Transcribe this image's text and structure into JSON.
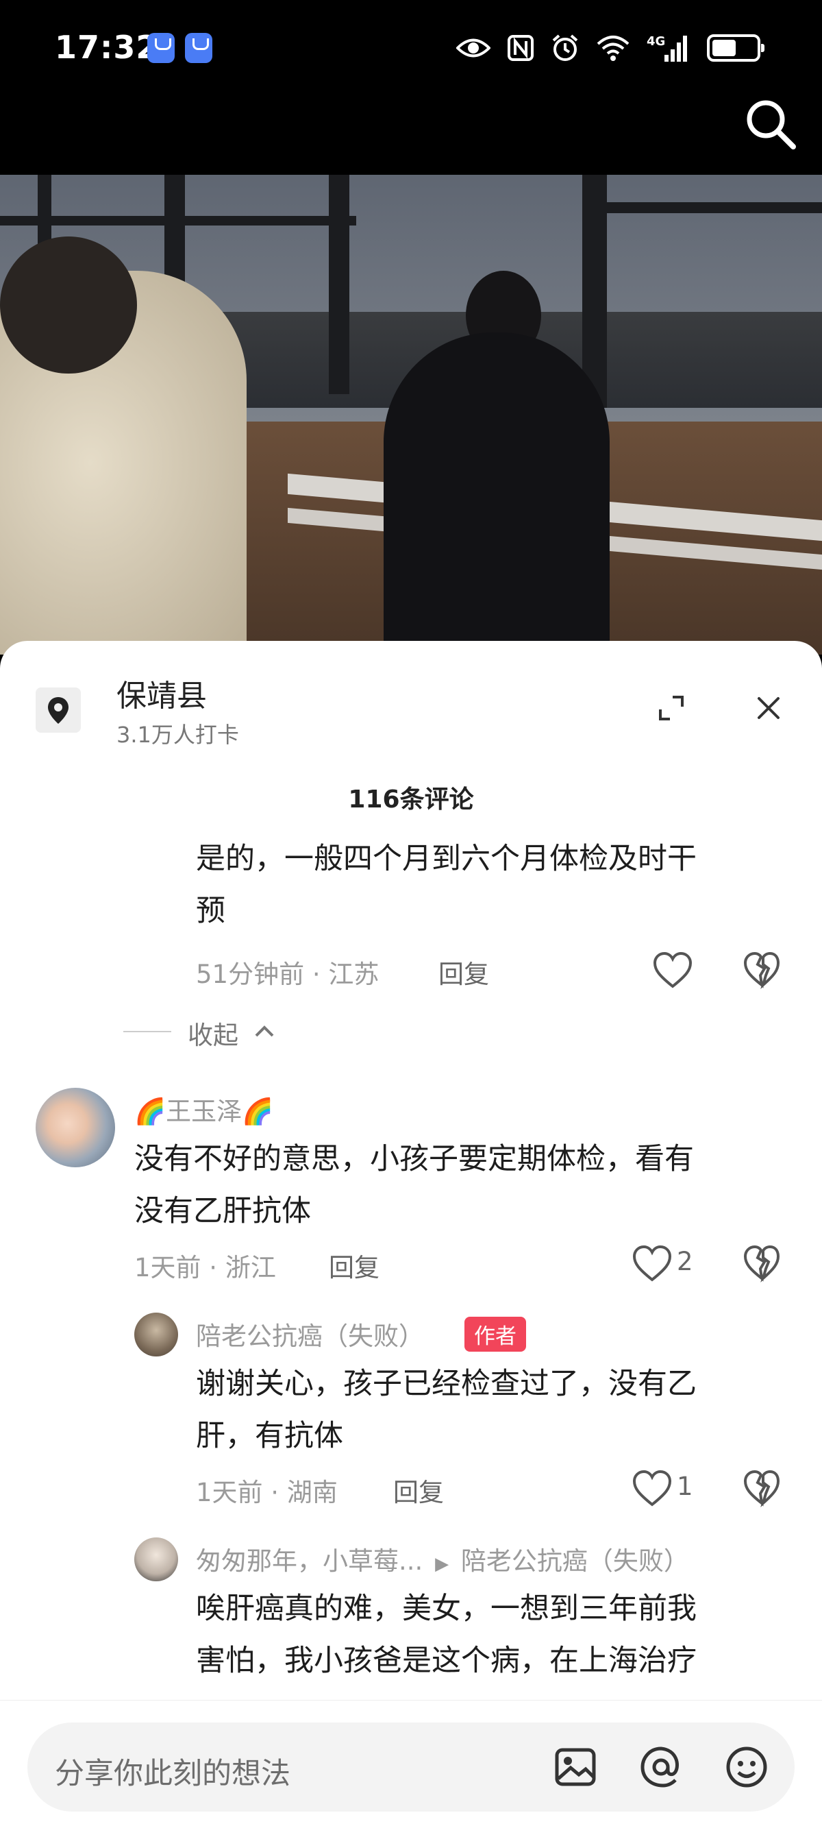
{
  "status_bar": {
    "time": "17:32",
    "icons": [
      "app-market-icon",
      "app-market-icon",
      "eye-icon",
      "nfc-icon",
      "alarm-icon",
      "wifi-icon",
      "4g-signal-icon",
      "battery-icon"
    ],
    "network_label": "4G"
  },
  "header": {
    "search_icon": "search-icon"
  },
  "video": {
    "description_icons": [
      "video-frame"
    ]
  },
  "location": {
    "icon": "location-pin-icon",
    "name": "保靖县",
    "checkins": "3.1万人打卡"
  },
  "comments_header": {
    "count_label": "116条评论"
  },
  "comments": [
    {
      "text_line1": "是的，一般四个月到六个月体检及时干",
      "text_line2": "预",
      "time": "51分钟前",
      "location": "江苏",
      "reply_label": "回复",
      "likes": ""
    }
  ],
  "collapse": {
    "label": "收起"
  },
  "comment2": {
    "username": "🌈王玉泽🌈",
    "text_line1": "没有不好的意思，小孩子要定期体检，看有",
    "text_line2": "没有乙肝抗体",
    "time": "1天前",
    "location": "浙江",
    "reply_label": "回复",
    "likes": "2"
  },
  "reply1": {
    "username": "陪老公抗癌（失败）",
    "badge": "作者",
    "text_line1": "谢谢关心，孩子已经检查过了，没有乙",
    "text_line2": "肝，有抗体",
    "time": "1天前",
    "location": "湖南",
    "reply_label": "回复",
    "likes": "1"
  },
  "reply2": {
    "username": "匆匆那年，小草莓...",
    "reply_to": "陪老公抗癌（失败）",
    "text_line1": "唉肝癌真的难，美女，一想到三年前我",
    "text_line2": "害怕，我小孩爸是这个病，在上海治疗"
  },
  "input_bar": {
    "placeholder": "分享你此刻的想法",
    "icons": [
      "image-icon",
      "at-icon",
      "emoji-icon"
    ]
  },
  "colors": {
    "badge": "#f2455a",
    "meta": "#9a9a9a",
    "text": "#1d1d1d"
  }
}
